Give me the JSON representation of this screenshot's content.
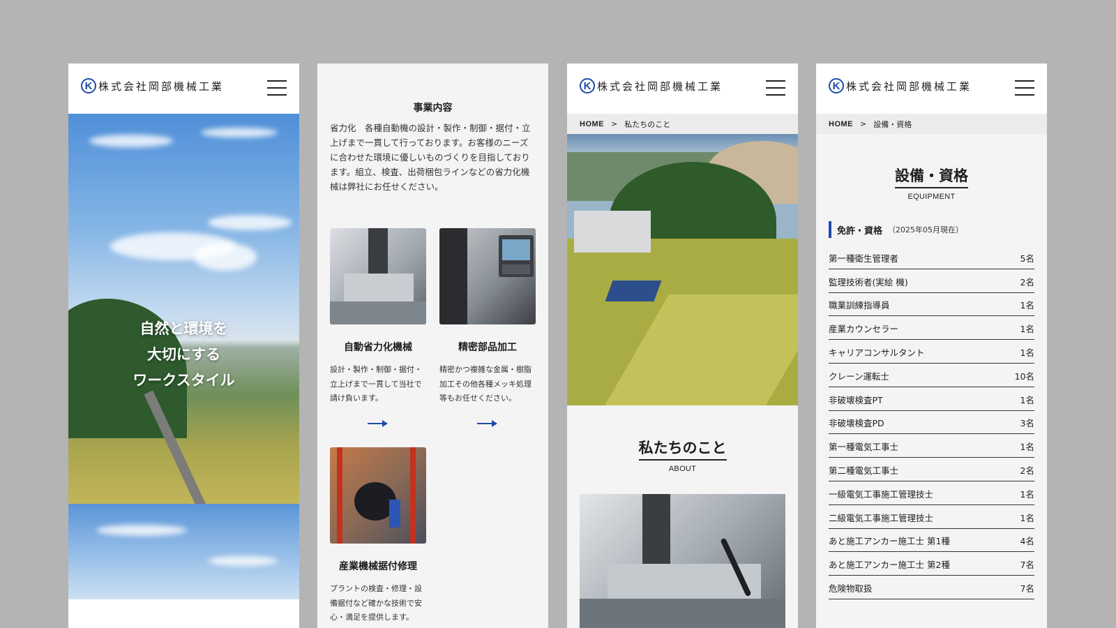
{
  "header": {
    "company_name": "株式会社岡部機械工業",
    "logo_letter": "K"
  },
  "screen1": {
    "hero_lines": [
      "自然と環境を",
      "大切にする",
      "ワークスタイル"
    ]
  },
  "screen2": {
    "section_title": "事業内容",
    "section_text": "省力化　各種自動機の設計・製作・制御・据付・立上げまで一貫して行っております。お客様のニーズに合わせた環境に優しいものづくりを目指しております。組立、検査、出荷梱包ラインなどの省力化機械は弊社にお任せください。",
    "cards": [
      {
        "title": "自動省力化機械",
        "text": "設計・製作・制御・据付・立上げまで一貫して当社で請け負います。"
      },
      {
        "title": "精密部品加工",
        "text": "精密かつ複雑な金属・樹脂加工その他各種メッキ処理等もお任せください。"
      },
      {
        "title": "産業機械据付修理",
        "text": "プラントの検査・修理・設備据付など確かな技術で安心・満足を提供します。"
      }
    ]
  },
  "screen3": {
    "breadcrumb": {
      "home": "HOME",
      "sep": ">",
      "current": "私たちのこと"
    },
    "heading": "私たちのこと",
    "heading_en": "ABOUT"
  },
  "screen4": {
    "breadcrumb": {
      "home": "HOME",
      "sep": ">",
      "current": "設備・資格"
    },
    "heading": "設備・資格",
    "heading_en": "EQUIPMENT",
    "license_title": "免許・資格",
    "license_date": "（2025年05月現在）",
    "licenses": [
      {
        "name": "第一種衛生管理者",
        "count": "5名"
      },
      {
        "name": "監理技術者(実絵 機)",
        "count": "2名"
      },
      {
        "name": "職業訓練指導員",
        "count": "1名"
      },
      {
        "name": "産業カウンセラー",
        "count": "1名"
      },
      {
        "name": "キャリアコンサルタント",
        "count": "1名"
      },
      {
        "name": "クレーン運転士",
        "count": "10名"
      },
      {
        "name": "非破壊検査PT",
        "count": "1名"
      },
      {
        "name": "非破壊検査PD",
        "count": "3名"
      },
      {
        "name": "第一種電気工事士",
        "count": "1名"
      },
      {
        "name": "第二種電気工事士",
        "count": "2名"
      },
      {
        "name": "一級電気工事施工管理技士",
        "count": "1名"
      },
      {
        "name": "二級電気工事施工管理技士",
        "count": "1名"
      },
      {
        "name": "あと施工アンカー施工士 第1種",
        "count": "4名"
      },
      {
        "name": "あと施工アンカー施工士 第2種",
        "count": "7名"
      },
      {
        "name": "危険物取扱",
        "count": "7名"
      }
    ]
  }
}
